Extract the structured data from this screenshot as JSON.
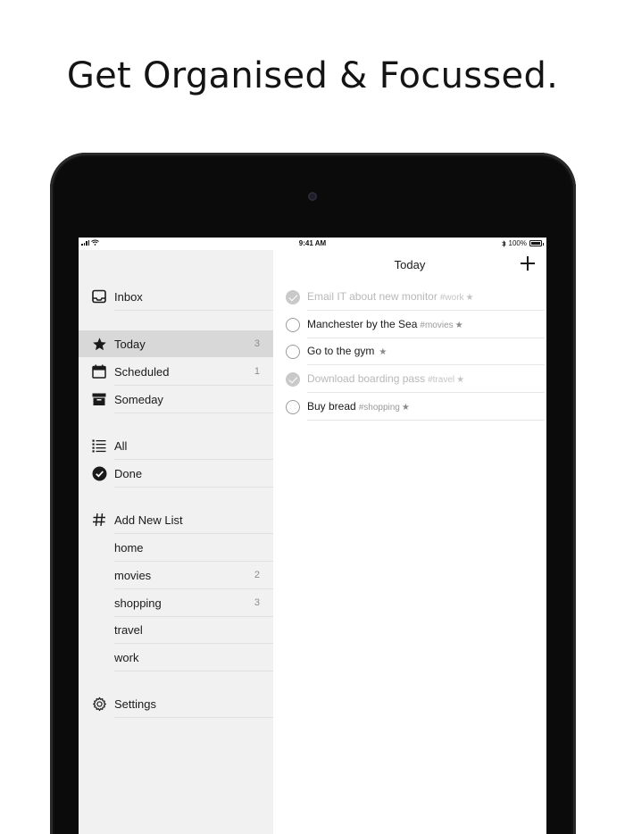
{
  "headline": "Get Organised & Focussed.",
  "status_bar": {
    "time": "9:41 AM",
    "battery": "100%"
  },
  "sidebar": {
    "inbox": {
      "label": "Inbox",
      "icon": "tray-icon"
    },
    "groups": [
      {
        "label": "Today",
        "count": "3",
        "icon": "star-icon",
        "active": true
      },
      {
        "label": "Scheduled",
        "count": "1",
        "icon": "calendar-icon"
      },
      {
        "label": "Someday",
        "count": "",
        "icon": "archive-box-icon"
      }
    ],
    "all": {
      "label": "All",
      "icon": "list-icon"
    },
    "done": {
      "label": "Done",
      "icon": "check-circle-icon"
    },
    "add_list": {
      "label": "Add New List",
      "icon": "hash-icon"
    },
    "lists": [
      {
        "label": "home",
        "count": ""
      },
      {
        "label": "movies",
        "count": "2"
      },
      {
        "label": "shopping",
        "count": "3"
      },
      {
        "label": "travel",
        "count": ""
      },
      {
        "label": "work",
        "count": ""
      }
    ],
    "settings": {
      "label": "Settings",
      "icon": "gear-icon"
    }
  },
  "main": {
    "title": "Today",
    "tasks": [
      {
        "text": "Email IT about new monitor",
        "tag": "#work",
        "star": "★",
        "done": true
      },
      {
        "text": "Manchester by the Sea",
        "tag": "#movies",
        "star": "★",
        "done": false
      },
      {
        "text": "Go to the gym",
        "tag": "",
        "star": "★",
        "done": false
      },
      {
        "text": "Download boarding pass",
        "tag": "#travel",
        "star": "★",
        "done": true
      },
      {
        "text": "Buy bread",
        "tag": "#shopping",
        "star": "★",
        "done": false
      }
    ]
  }
}
